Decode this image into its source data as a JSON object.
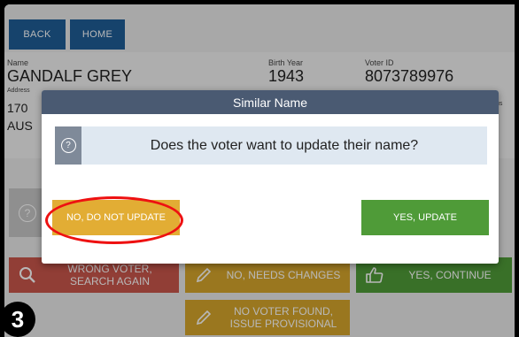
{
  "nav": {
    "back_label": "BACK",
    "home_label": "HOME"
  },
  "voter": {
    "name_label": "Name",
    "name_value": "GANDALF GREY",
    "birth_label": "Birth Year",
    "birth_value": "1943",
    "id_label": "Voter ID",
    "id_value": "8073789976",
    "address_label_partial": "Address",
    "address_line1_partial": "170",
    "address_line2_partial": "AUS",
    "status_partial": "us"
  },
  "workflow": {
    "wrong_voter_label_1": "WRONG VOTER,",
    "wrong_voter_label_2": "SEARCH AGAIN",
    "needs_changes_label": "NO, NEEDS CHANGES",
    "yes_continue_label": "YES, CONTINUE",
    "no_voter_label_1": "NO VOTER FOUND,",
    "no_voter_label_2": "ISSUE PROVISIONAL",
    "right_help_partial": "?"
  },
  "modal": {
    "title": "Similar Name",
    "question": "Does the voter want to update their name?",
    "no_label": "NO, DO NOT UPDATE",
    "yes_label": "YES, UPDATE"
  },
  "step_badge": "3",
  "colors": {
    "nav_blue": "#1f5d96",
    "modal_header": "#4a5a72",
    "red_button": "#c9564c",
    "yellow_button": "#d6a62b",
    "green_button": "#4f9b38",
    "annotation_red": "#e11111"
  },
  "icons": [
    "help-icon",
    "search-icon",
    "pencil-icon",
    "thumbs-up-icon"
  ]
}
